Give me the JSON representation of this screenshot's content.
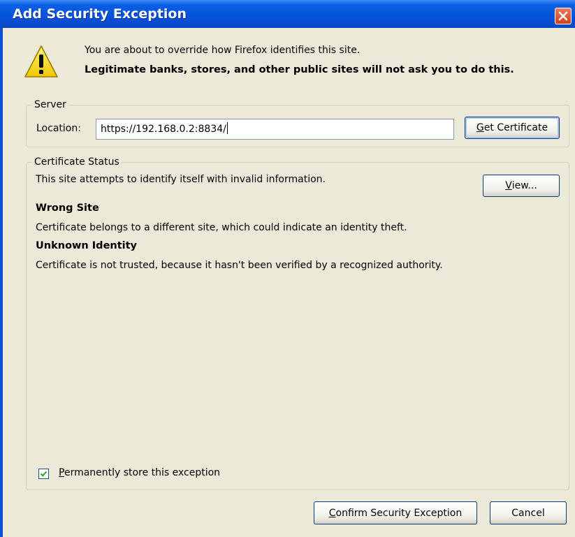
{
  "dialog": {
    "title": "Add Security Exception",
    "intro_line1": "You are about to override how Firefox identifies this site.",
    "intro_line2": "Legitimate banks, stores, and other public sites will not ask you to do this."
  },
  "server": {
    "legend": "Server",
    "location_label": "Location:",
    "location_value": "https://192.168.0.2:8834/",
    "get_certificate": {
      "mnemonic": "G",
      "rest": "et Certificate"
    }
  },
  "status": {
    "legend": "Certificate Status",
    "summary": "This site attempts to identify itself with invalid information.",
    "view_button": {
      "mnemonic": "V",
      "rest": "iew..."
    },
    "issues": [
      {
        "title": "Wrong Site",
        "description": "Certificate belongs to a different site, which could indicate an identity theft."
      },
      {
        "title": "Unknown Identity",
        "description": "Certificate is not trusted, because it hasn't been verified by a recognized authority."
      }
    ],
    "permanent_checkbox": {
      "checked": true,
      "mnemonic": "P",
      "rest": "ermanently store this exception"
    }
  },
  "buttons": {
    "confirm": {
      "mnemonic": "C",
      "rest": "onfirm Security Exception"
    },
    "cancel": "Cancel"
  },
  "colors": {
    "titlebar": "#0652dc",
    "window_bg": "#ece9d8",
    "close_button": "#d5401e",
    "warning_yellow": "#f5d200"
  },
  "icons": {
    "warning": "warning-triangle-icon",
    "close": "close-icon",
    "check": "check-icon"
  }
}
